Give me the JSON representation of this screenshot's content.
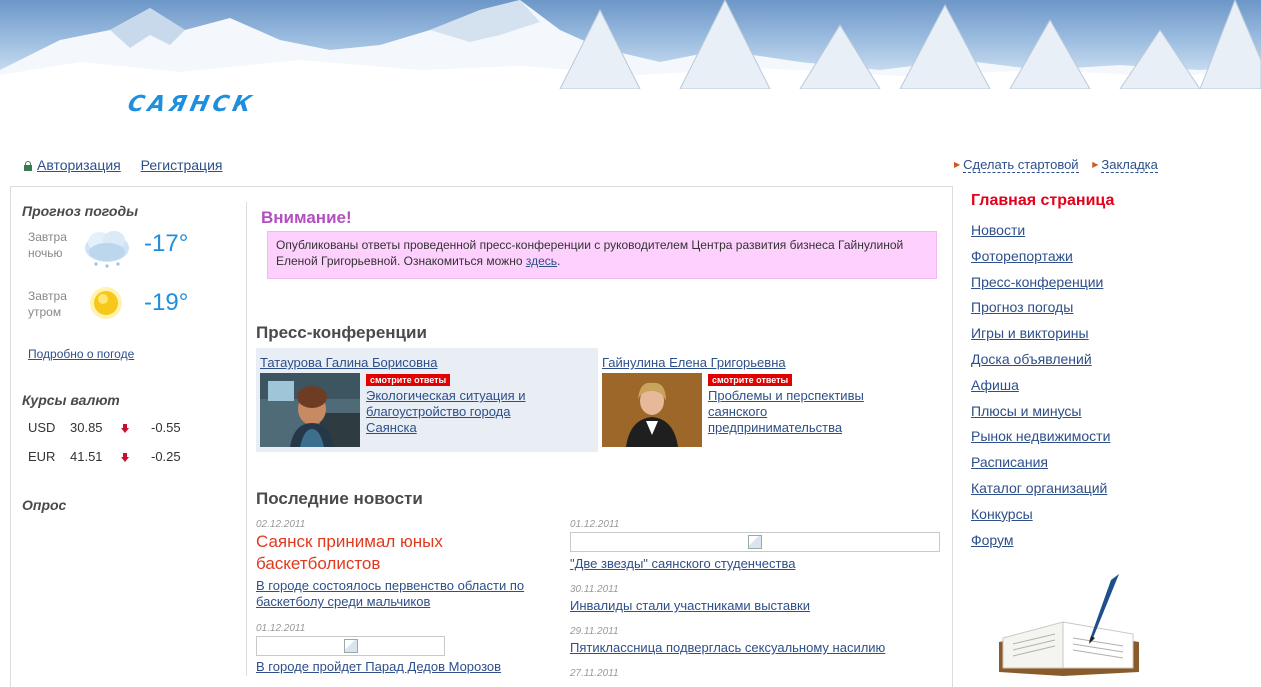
{
  "header": {
    "logo_text": "САЯНСК"
  },
  "top_links": {
    "login": "Авторизация",
    "register": "Регистрация",
    "make_start": "Сделать стартовой",
    "bookmark": "Закладка"
  },
  "weather": {
    "title": "Прогноз погоды",
    "night_label_1": "Завтра",
    "night_label_2": "ночью",
    "night_temp": "-17°",
    "morning_label_1": "Завтра",
    "morning_label_2": "утром",
    "morning_temp": "-19°",
    "more_link": "Подробно о погоде"
  },
  "currency": {
    "title": "Курсы валют",
    "rows": [
      {
        "code": "USD",
        "rate": "30.85",
        "change": "-0.55"
      },
      {
        "code": "EUR",
        "rate": "41.51",
        "change": "-0.25"
      }
    ]
  },
  "poll": {
    "title": "Опрос"
  },
  "attention": {
    "title": "Внимание!",
    "text": "Опубликованы ответы проведенной пресс-конференции с руководителем Центра развития бизнеса Гайнулиной Еленой Григорьевной. Ознакомиться можно ",
    "link": "здесь",
    "tail": "."
  },
  "press": {
    "title": "Пресс-конференции",
    "cards": [
      {
        "name": "Татаурова Галина Борисовна",
        "badge": "смотрите ответы",
        "topic": "Экологическая ситуация и благоустройство города Саянска"
      },
      {
        "name": "Гайнулина Елена Григорьевна",
        "badge": "смотрите ответы",
        "topic": "Проблемы и перспективы саянского предпринимательства"
      }
    ]
  },
  "news": {
    "title": "Последние новости",
    "left": [
      {
        "date": "02.12.2011",
        "headline": "Саянск принимал юных баскетболистов",
        "link": "В городе состоялось первенство области по баскетболу среди мальчиков"
      },
      {
        "date": "01.12.2011",
        "link": "В городе пройдет Парад Дедов Морозов"
      }
    ],
    "right": [
      {
        "date": "01.12.2011",
        "link": "\"Две звезды\" саянского студенчества"
      },
      {
        "date": "30.11.2011",
        "link": "Инвалиды стали участниками выставки"
      },
      {
        "date": "29.11.2011",
        "link": "Пятиклассница подверглась сексуальному насилию"
      },
      {
        "date": "27.11.2011",
        "link": ""
      }
    ]
  },
  "menu": {
    "title": "Главная страница",
    "items": [
      "Новости",
      "Фоторепортажи",
      "Пресс-конференции",
      "Прогноз погоды",
      "Игры и викторины",
      "Доска объявлений",
      "Афиша",
      "Плюсы и минусы",
      "Рынок недвижимости",
      "Расписания",
      "Каталог организаций",
      "Конкурсы",
      "Форум"
    ]
  },
  "colors": {
    "link": "#2d4f8a",
    "attention_title": "#b44fbf",
    "attention_bg": "#fdd0fd",
    "menu_title": "#e3001b",
    "headline": "#e03a1e",
    "temp": "#1e8fde",
    "badge": "#e30000"
  }
}
